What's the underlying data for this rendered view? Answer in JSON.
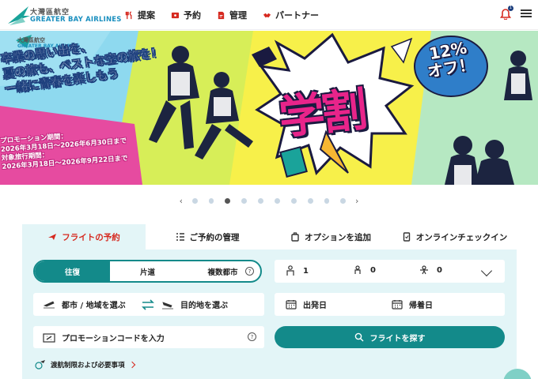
{
  "header": {
    "logo_cn": "大灣區航空",
    "logo_en": "GREATER BAY AIRLINES",
    "nav": [
      {
        "label": "提案",
        "icon": "fork-knife-icon"
      },
      {
        "label": "予約",
        "icon": "ticket-icon"
      },
      {
        "label": "管理",
        "icon": "document-icon"
      },
      {
        "label": "パートナー",
        "icon": "handshake-icon"
      }
    ],
    "notification_count": "1"
  },
  "banner": {
    "logo_cn": "大灣區航空",
    "logo_en": "GREATER BAY AIRLINES",
    "slogan_line1": "卒業の思い出を、",
    "slogan_line2": "夏の旅も、ベストな空の旅を！",
    "slogan_line3": "一緒に青春を楽しもう",
    "promo_period_label": "プロモーション期間：",
    "promo_period": "2026年3月18日～2026年6月30日まで",
    "travel_period_label": "対象旅行期間：",
    "travel_period": "2026年3月18日～2026年9月22日まで",
    "main_text": "学割",
    "discount": "12%",
    "discount_suffix": "オフ！"
  },
  "carousel": {
    "total": 10,
    "active_index": 2
  },
  "booking": {
    "tabs": [
      {
        "label": "フライトの予約",
        "icon": "plane-icon"
      },
      {
        "label": "ご予約の管理",
        "icon": "list-icon"
      },
      {
        "label": "オプションを追加",
        "icon": "luggage-icon"
      },
      {
        "label": "オンラインチェックイン",
        "icon": "phone-checkin-icon"
      }
    ],
    "trip_types": [
      "往復",
      "片道",
      "複数都市"
    ],
    "passengers": {
      "adult": "1",
      "child": "0",
      "infant": "0"
    },
    "origin_placeholder": "都市 / 地域を選ぶ",
    "destination_placeholder": "目的地を選ぶ",
    "departure_label": "出発日",
    "return_label": "帰着日",
    "promo_placeholder": "プロモーションコードを入力",
    "search_label": "フライトを探す",
    "notes_label": "渡航制限および必要事項"
  },
  "colors": {
    "accent": "#138a8a",
    "red": "#d6291f",
    "panel": "#e3f5f7"
  }
}
